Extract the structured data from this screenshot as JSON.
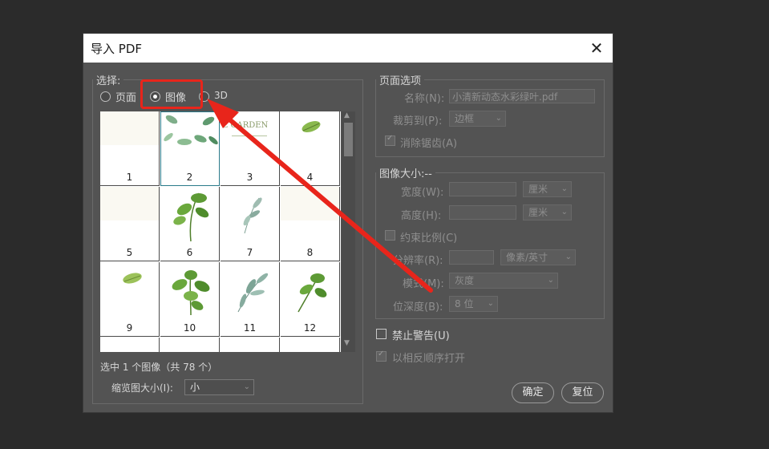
{
  "dialog": {
    "title": "导入 PDF",
    "close_icon": "close-icon"
  },
  "select_section": {
    "legend": "选择:",
    "options": [
      {
        "label": "页面",
        "selected": false
      },
      {
        "label": "图像",
        "selected": true
      },
      {
        "label": "3D",
        "selected": false
      }
    ]
  },
  "thumbnails": [
    {
      "number": "1",
      "image": "blank-page"
    },
    {
      "number": "2",
      "image": "leaf-wreath",
      "selected": true
    },
    {
      "number": "3",
      "image": "title-garden"
    },
    {
      "number": "4",
      "image": "leaf"
    },
    {
      "number": "5",
      "image": "blank-page"
    },
    {
      "number": "6",
      "image": "leaf-branch"
    },
    {
      "number": "7",
      "image": "leaf-sprig"
    },
    {
      "number": "8",
      "image": "blank-page"
    },
    {
      "number": "9",
      "image": "leaf"
    },
    {
      "number": "10",
      "image": "leaf-cluster"
    },
    {
      "number": "11",
      "image": "leaf-sprig"
    },
    {
      "number": "12",
      "image": "leaf-branch"
    },
    {
      "number": "",
      "image": "blank"
    },
    {
      "number": "",
      "image": "blank"
    },
    {
      "number": "",
      "image": "blank"
    },
    {
      "number": "",
      "image": "blank"
    }
  ],
  "thumb_title_text": "E GARDEN",
  "selection_status": "选中 1 个图像（共 78 个）",
  "thumb_size": {
    "label": "缩览图大小(I):",
    "value": "小"
  },
  "page_options": {
    "legend": "页面选项",
    "name_label": "名称(N):",
    "name_value": "小清新动态水彩绿叶.pdf",
    "crop_label": "裁剪到(P):",
    "crop_value": "边框",
    "antialias_label": "消除锯齿(A)",
    "antialias_checked": true
  },
  "image_size": {
    "legend": "图像大小:--",
    "width_label": "宽度(W):",
    "width_value": "",
    "width_unit": "厘米",
    "height_label": "高度(H):",
    "height_value": "",
    "height_unit": "厘米",
    "constrain_label": "约束比例(C)",
    "resolution_label": "分辨率(R):",
    "resolution_value": "",
    "resolution_unit": "像素/英寸",
    "mode_label": "模式(M):",
    "mode_value": "灰度",
    "depth_label": "位深度(B):",
    "depth_value": "8 位"
  },
  "suppress_warnings": {
    "label": "禁止警告(U)",
    "checked": false
  },
  "reverse_order": {
    "label": "以相反顺序打开",
    "checked": true,
    "disabled": true
  },
  "buttons": {
    "ok": "确定",
    "reset": "复位"
  },
  "annotation": {
    "color": "#e8251b"
  }
}
